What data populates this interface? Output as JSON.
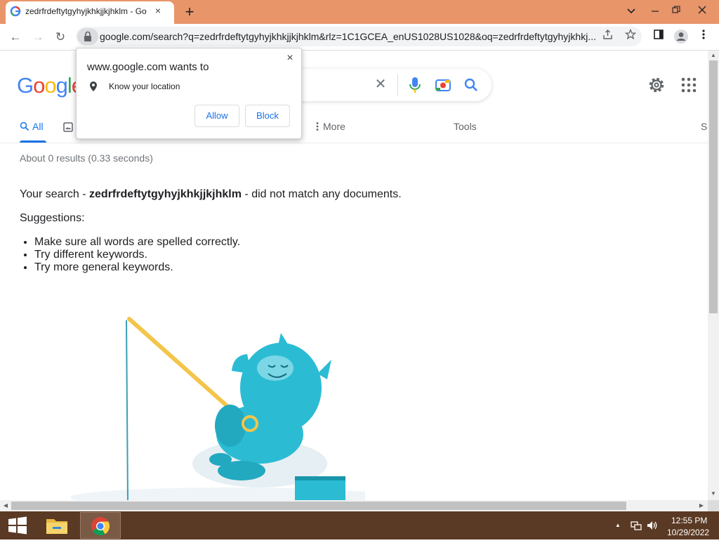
{
  "browser": {
    "tab_title": "zedrfrdeftytgyhyjkhkjjkjhklm - Go",
    "tab_close": "×",
    "new_tab": "+",
    "window_controls": {
      "min": "⌄",
      "restore": "–",
      "maximize": "❐",
      "close": "✕"
    },
    "url": "google.com/search?q=zedrfrdeftytgyhyjkhkjjkjhklm&rlz=1C1GCEA_enUS1028US1028&oq=zedrfrdeftytgyhyjkhkj...",
    "back": "←",
    "forward": "→",
    "reload": "↻"
  },
  "google": {
    "logo_letters": [
      {
        "ch": "G",
        "color": "#4285f4"
      },
      {
        "ch": "o",
        "color": "#ea4335"
      },
      {
        "ch": "o",
        "color": "#fbbc05"
      },
      {
        "ch": "g",
        "color": "#4285f4"
      },
      {
        "ch": "l",
        "color": "#34a853"
      },
      {
        "ch": "e",
        "color": "#ea4335"
      }
    ],
    "clear_icon": "✕",
    "nav": {
      "all": "All",
      "more": "More",
      "tools": "Tools",
      "partial_right": "S"
    },
    "stats": "About 0 results (0.33 seconds)",
    "no_result": {
      "prefix": "Your search - ",
      "query": "zedrfrdeftytgyhyjkhkjjkjhklm",
      "suffix": " - did not match any documents."
    },
    "suggestions_title": "Suggestions:",
    "suggestions": [
      "Make sure all words are spelled correctly.",
      "Try different keywords.",
      "Try more general keywords."
    ]
  },
  "permission": {
    "title": "www.google.com wants to",
    "description": "Know your location",
    "allow": "Allow",
    "block": "Block",
    "close": "×"
  },
  "taskbar": {
    "time": "12:55 PM",
    "date": "10/29/2022",
    "tray_up": "▲"
  },
  "colors": {
    "accent": "#1a73e8",
    "titlebar": "#e8956a",
    "taskbar": "#5a3a24"
  }
}
